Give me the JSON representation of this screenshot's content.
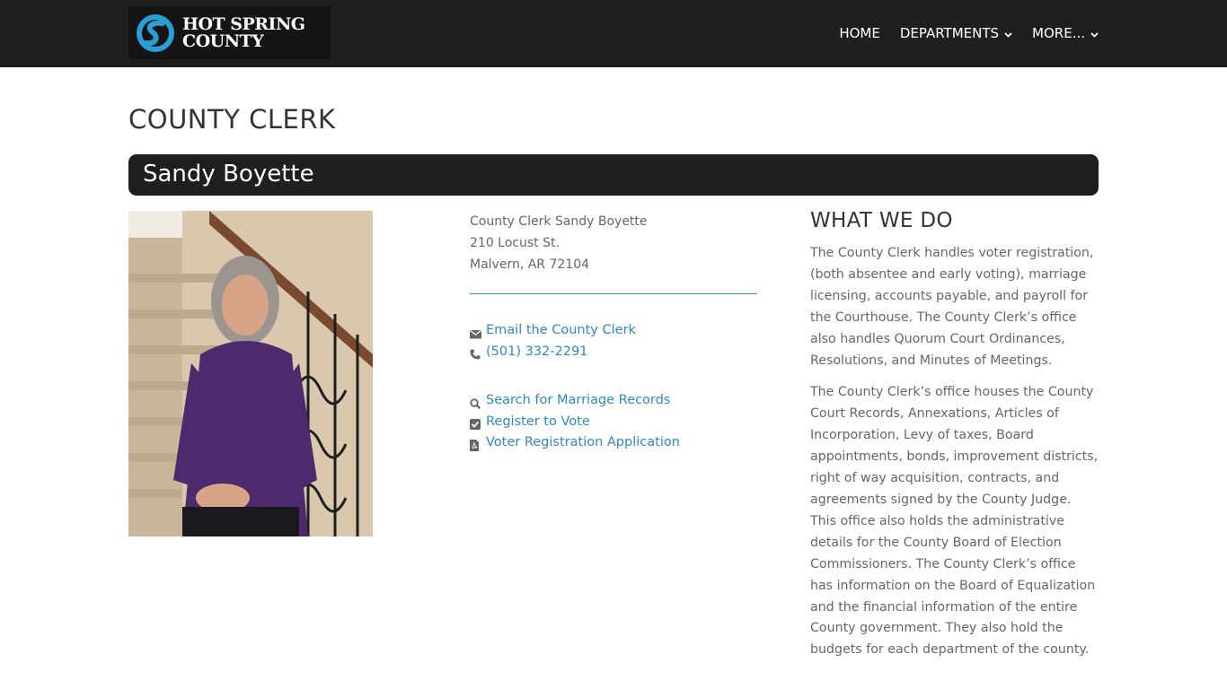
{
  "header": {
    "logo_line1": "HOT SPRING",
    "logo_line2": "COUNTY",
    "nav": [
      {
        "label": "HOME"
      },
      {
        "label": "DEPARTMENTS"
      },
      {
        "label": "MORE..."
      }
    ]
  },
  "page": {
    "title": "COUNTY CLERK",
    "person_name": "Sandy Boyette"
  },
  "contact": {
    "title_line": "County Clerk Sandy Boyette",
    "street": "210 Locust St.",
    "city": "Malvern, AR 72104",
    "email_link": "Email the County Clerk",
    "phone_link": "(501) 332-2291",
    "marriage_link": "Search for Marriage Records",
    "register_link": "Register to Vote",
    "application_link": "Voter Registration Application"
  },
  "what_we_do": {
    "heading": "WHAT WE DO",
    "paragraph1": "The County Clerk handles voter registration, (both absentee and early voting), marriage licensing, accounts payable, and payroll for the Courthouse. The County Clerk’s office also handles Quorum Court Ordinances, Resolutions, and Minutes of Meetings.",
    "paragraph2": "The County Clerk’s office houses the County Court Records, Annexations, Articles of Incorporation, Levy of taxes, Board appointments, bonds, improvement districts, right of way acquisition, contracts, and agreements signed by the County Judge. This office also holds the administrative details for the County Board of Election Commissioners. The County Clerk’s office has information on the Board of Equalization and the financial information of the entire County government. They also hold the budgets for each department of the county."
  },
  "colors": {
    "header_bg": "#1f1f1f",
    "link": "#2e8ac0",
    "logo_accent": "#2a9fd6"
  }
}
